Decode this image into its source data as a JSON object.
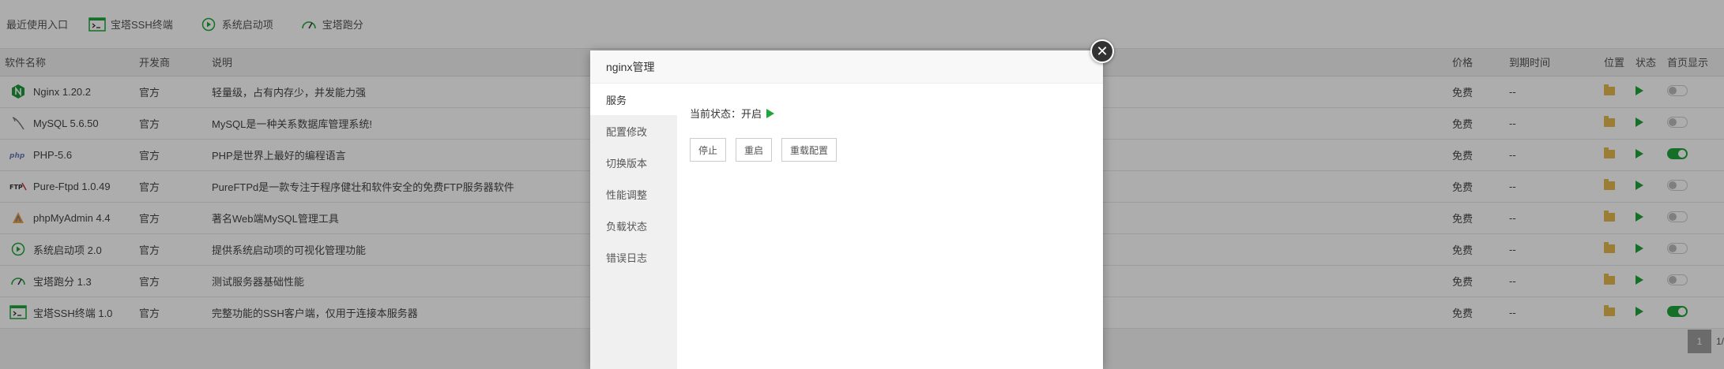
{
  "recent": {
    "title": "最近使用入口",
    "items": [
      {
        "label": "宝塔SSH终端",
        "icon": "terminal-icon"
      },
      {
        "label": "系统启动项",
        "icon": "play-circle-icon"
      },
      {
        "label": "宝塔跑分",
        "icon": "gauge-icon"
      }
    ]
  },
  "table": {
    "headers": {
      "name": "软件名称",
      "developer": "开发商",
      "desc": "说明",
      "price": "价格",
      "expire": "到期时间",
      "location": "位置",
      "status": "状态",
      "homepage": "首页显示"
    },
    "rows": [
      {
        "name": "Nginx 1.20.2",
        "icon": "nginx-icon",
        "developer": "官方",
        "desc": "轻量级，占有内存少，并发能力强",
        "price": "免费",
        "expire": "--",
        "home_on": false
      },
      {
        "name": "MySQL 5.6.50",
        "icon": "mysql-icon",
        "developer": "官方",
        "desc": "MySQL是一种关系数据库管理系统!",
        "price": "免费",
        "expire": "--",
        "home_on": false
      },
      {
        "name": "PHP-5.6",
        "icon": "php-icon",
        "developer": "官方",
        "desc": "PHP是世界上最好的编程语言",
        "price": "免费",
        "expire": "--",
        "home_on": true
      },
      {
        "name": "Pure-Ftpd 1.0.49",
        "icon": "ftp-icon",
        "developer": "官方",
        "desc": "PureFTPd是一款专注于程序健壮和软件安全的免费FTP服务器软件",
        "price": "免费",
        "expire": "--",
        "home_on": false
      },
      {
        "name": "phpMyAdmin 4.4",
        "icon": "phpmyadmin-icon",
        "developer": "官方",
        "desc": "著名Web端MySQL管理工具",
        "price": "免费",
        "expire": "--",
        "home_on": false
      },
      {
        "name": "系统启动项 2.0",
        "icon": "play-circle-icon",
        "developer": "官方",
        "desc": "提供系统启动项的可视化管理功能",
        "price": "免费",
        "expire": "--",
        "home_on": false
      },
      {
        "name": "宝塔跑分 1.3",
        "icon": "gauge-icon",
        "developer": "官方",
        "desc": "测试服务器基础性能",
        "price": "免费",
        "expire": "--",
        "home_on": false
      },
      {
        "name": "宝塔SSH终端 1.0",
        "icon": "terminal-icon",
        "developer": "官方",
        "desc": "完整功能的SSH客户端，仅用于连接本服务器",
        "price": "免费",
        "expire": "--",
        "home_on": true
      }
    ]
  },
  "pager": {
    "current": "1",
    "text": "1/"
  },
  "modal": {
    "title": "nginx管理",
    "menu": [
      "服务",
      "配置修改",
      "切换版本",
      "性能调整",
      "负载状态",
      "错误日志"
    ],
    "status_label": "当前状态：开启",
    "buttons": {
      "stop": "停止",
      "restart": "重启",
      "reload": "重载配置"
    }
  },
  "colors": {
    "accent": "#20a53a",
    "folder": "#e5b94e"
  }
}
